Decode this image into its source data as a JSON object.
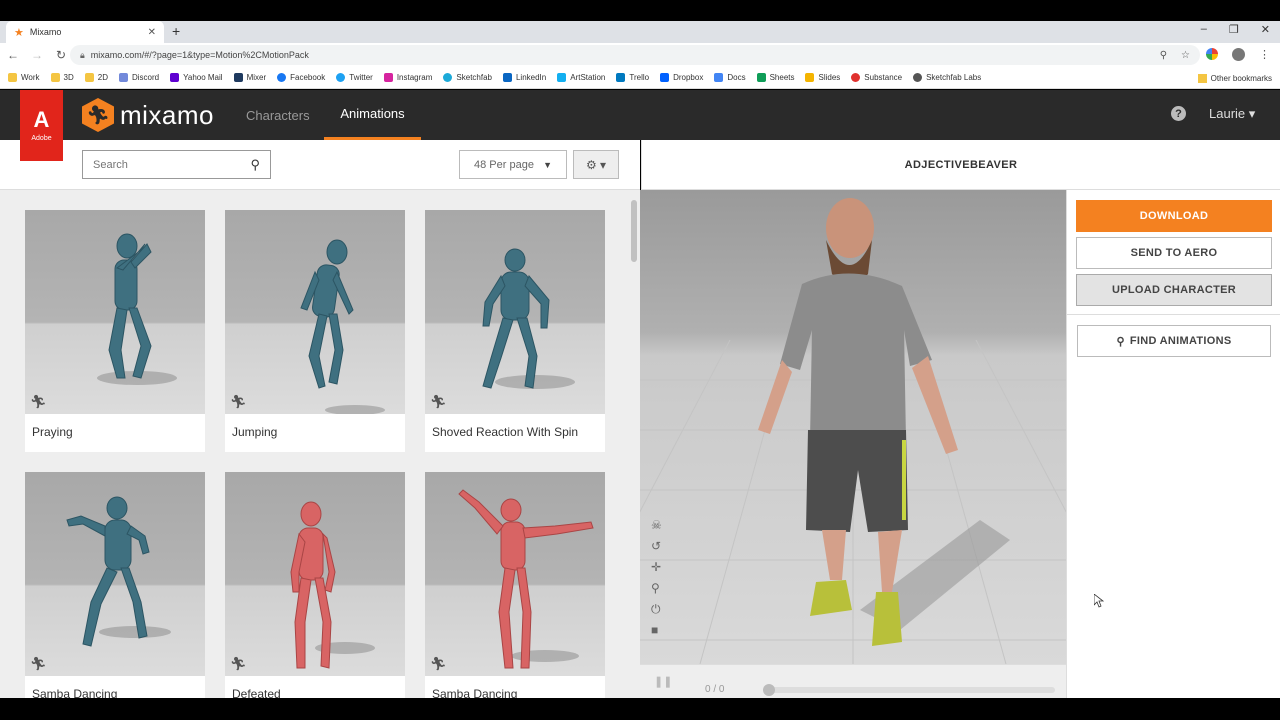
{
  "browser": {
    "tab_title": "Mixamo",
    "url": "mixamo.com/#/?page=1&type=Motion%2CMotionPack",
    "bookmarks": [
      "Work",
      "3D",
      "2D",
      "Discord",
      "Yahoo Mail",
      "Mixer",
      "Facebook",
      "Twitter",
      "Instagram",
      "Sketchfab",
      "LinkedIn",
      "ArtStation",
      "Trello",
      "Dropbox",
      "Docs",
      "Sheets",
      "Slides",
      "Substance",
      "Sketchfab Labs"
    ],
    "other_bookmarks": "Other bookmarks"
  },
  "header": {
    "adobe_label": "Adobe",
    "logo_text": "mixamo",
    "nav": {
      "characters": "Characters",
      "animations": "Animations"
    },
    "help": "?",
    "user": "Laurie ▾"
  },
  "toolbar": {
    "search_placeholder": "Search",
    "per_page": "48 Per page"
  },
  "cards": [
    {
      "label": "Praying"
    },
    {
      "label": "Jumping"
    },
    {
      "label": "Shoved Reaction With Spin"
    },
    {
      "label": "Samba Dancing"
    },
    {
      "label": "Defeated"
    },
    {
      "label": "Samba Dancing"
    }
  ],
  "viewer": {
    "character_name": "ADJECTIVEBEAVER",
    "time": "0 / 0"
  },
  "actions": {
    "download": "DOWNLOAD",
    "send_to_aero": "SEND TO AERO",
    "upload_character": "UPLOAD CHARACTER",
    "find_animations": "FIND ANIMATIONS"
  },
  "colors": {
    "accent": "#f48120",
    "adobe_red": "#e1251b",
    "header_bg": "#2a2a2a"
  }
}
